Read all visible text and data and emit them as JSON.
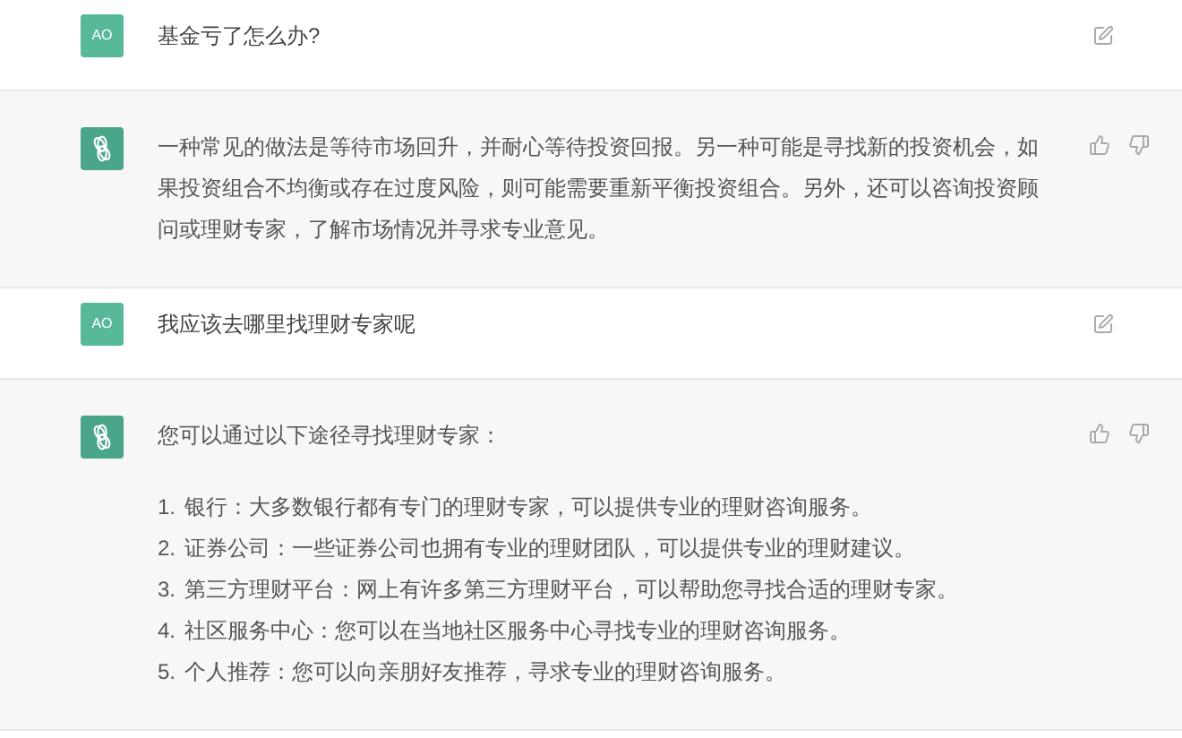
{
  "messages": [
    {
      "kind": "user",
      "avatar": "AO",
      "text": "基金亏了怎么办?"
    },
    {
      "kind": "assistant",
      "paragraphs": [
        "一种常见的做法是等待市场回升，并耐心等待投资回报。另一种可能是寻找新的投资机会，如果投资组合不均衡或存在过度风险，则可能需要重新平衡投资组合。另外，还可以咨询投资顾问或理财专家，了解市场情况并寻求专业意见。"
      ]
    },
    {
      "kind": "user",
      "avatar": "AO",
      "text": "我应该去哪里找理财专家呢"
    },
    {
      "kind": "assistant",
      "paragraphs": [
        "您可以通过以下途径寻找理财专家："
      ],
      "list": [
        {
          "number": "1.",
          "text": "银行：大多数银行都有专门的理财专家，可以提供专业的理财咨询服务。"
        },
        {
          "number": "2.",
          "text": "证券公司：一些证券公司也拥有专业的理财团队，可以提供专业的理财建议。"
        },
        {
          "number": "3.",
          "text": "第三方理财平台：网上有许多第三方理财平台，可以帮助您寻找合适的理财专家。"
        },
        {
          "number": "4.",
          "text": "社区服务中心：您可以在当地社区服务中心寻找专业的理财咨询服务。"
        },
        {
          "number": "5.",
          "text": "个人推荐：您可以向亲朋好友推荐，寻求专业的理财咨询服务。"
        }
      ]
    }
  ]
}
